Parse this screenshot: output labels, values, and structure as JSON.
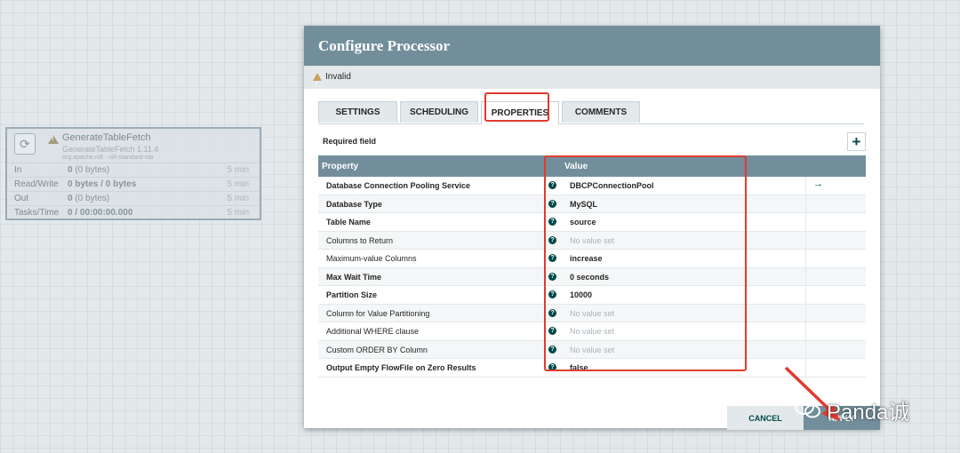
{
  "processor_node": {
    "name": "GenerateTableFetch",
    "version": "GenerateTableFetch 1.11.4",
    "bundle": "org.apache.nifi - nifi-standard-nar",
    "stats": [
      {
        "label": "In",
        "value": "0",
        "detail": "(0 bytes)",
        "time": "5 min"
      },
      {
        "label": "Read/Write",
        "value": "0 bytes / 0 bytes",
        "detail": "",
        "time": "5 min"
      },
      {
        "label": "Out",
        "value": "0",
        "detail": "(0 bytes)",
        "time": "5 min"
      },
      {
        "label": "Tasks/Time",
        "value": "0 / 00:00:00.000",
        "detail": "",
        "time": "5 min"
      }
    ]
  },
  "dialog": {
    "title": "Configure Processor",
    "status": "Invalid",
    "tabs": [
      {
        "label": "SETTINGS"
      },
      {
        "label": "SCHEDULING"
      },
      {
        "label": "PROPERTIES"
      },
      {
        "label": "COMMENTS"
      }
    ],
    "active_tab": "PROPERTIES",
    "required_field_label": "Required field",
    "add_label": "+",
    "table": {
      "headers": {
        "property": "Property",
        "value": "Value"
      },
      "rows": [
        {
          "property": "Database Connection Pooling Service",
          "required": true,
          "value": "DBCPConnectionPool",
          "has_value": true,
          "goto": true
        },
        {
          "property": "Database Type",
          "required": true,
          "value": "MySQL",
          "has_value": true,
          "goto": false
        },
        {
          "property": "Table Name",
          "required": true,
          "value": "source",
          "has_value": true,
          "goto": false
        },
        {
          "property": "Columns to Return",
          "required": false,
          "value": "No value set",
          "has_value": false,
          "goto": false
        },
        {
          "property": "Maximum-value Columns",
          "required": false,
          "value": "increase",
          "has_value": true,
          "goto": false
        },
        {
          "property": "Max Wait Time",
          "required": true,
          "value": "0 seconds",
          "has_value": true,
          "goto": false
        },
        {
          "property": "Partition Size",
          "required": true,
          "value": "10000",
          "has_value": true,
          "goto": false
        },
        {
          "property": "Column for Value Partitioning",
          "required": false,
          "value": "No value set",
          "has_value": false,
          "goto": false
        },
        {
          "property": "Additional WHERE clause",
          "required": false,
          "value": "No value set",
          "has_value": false,
          "goto": false
        },
        {
          "property": "Custom ORDER BY Column",
          "required": false,
          "value": "No value set",
          "has_value": false,
          "goto": false
        },
        {
          "property": "Output Empty FlowFile on Zero Results",
          "required": true,
          "value": "false",
          "has_value": true,
          "goto": false
        }
      ]
    },
    "buttons": {
      "cancel": "CANCEL",
      "apply": "APPLY"
    }
  },
  "watermark": "Panda诚",
  "colors": {
    "header": "#728e9b",
    "highlight": "#e03b30",
    "accent": "#004849"
  }
}
